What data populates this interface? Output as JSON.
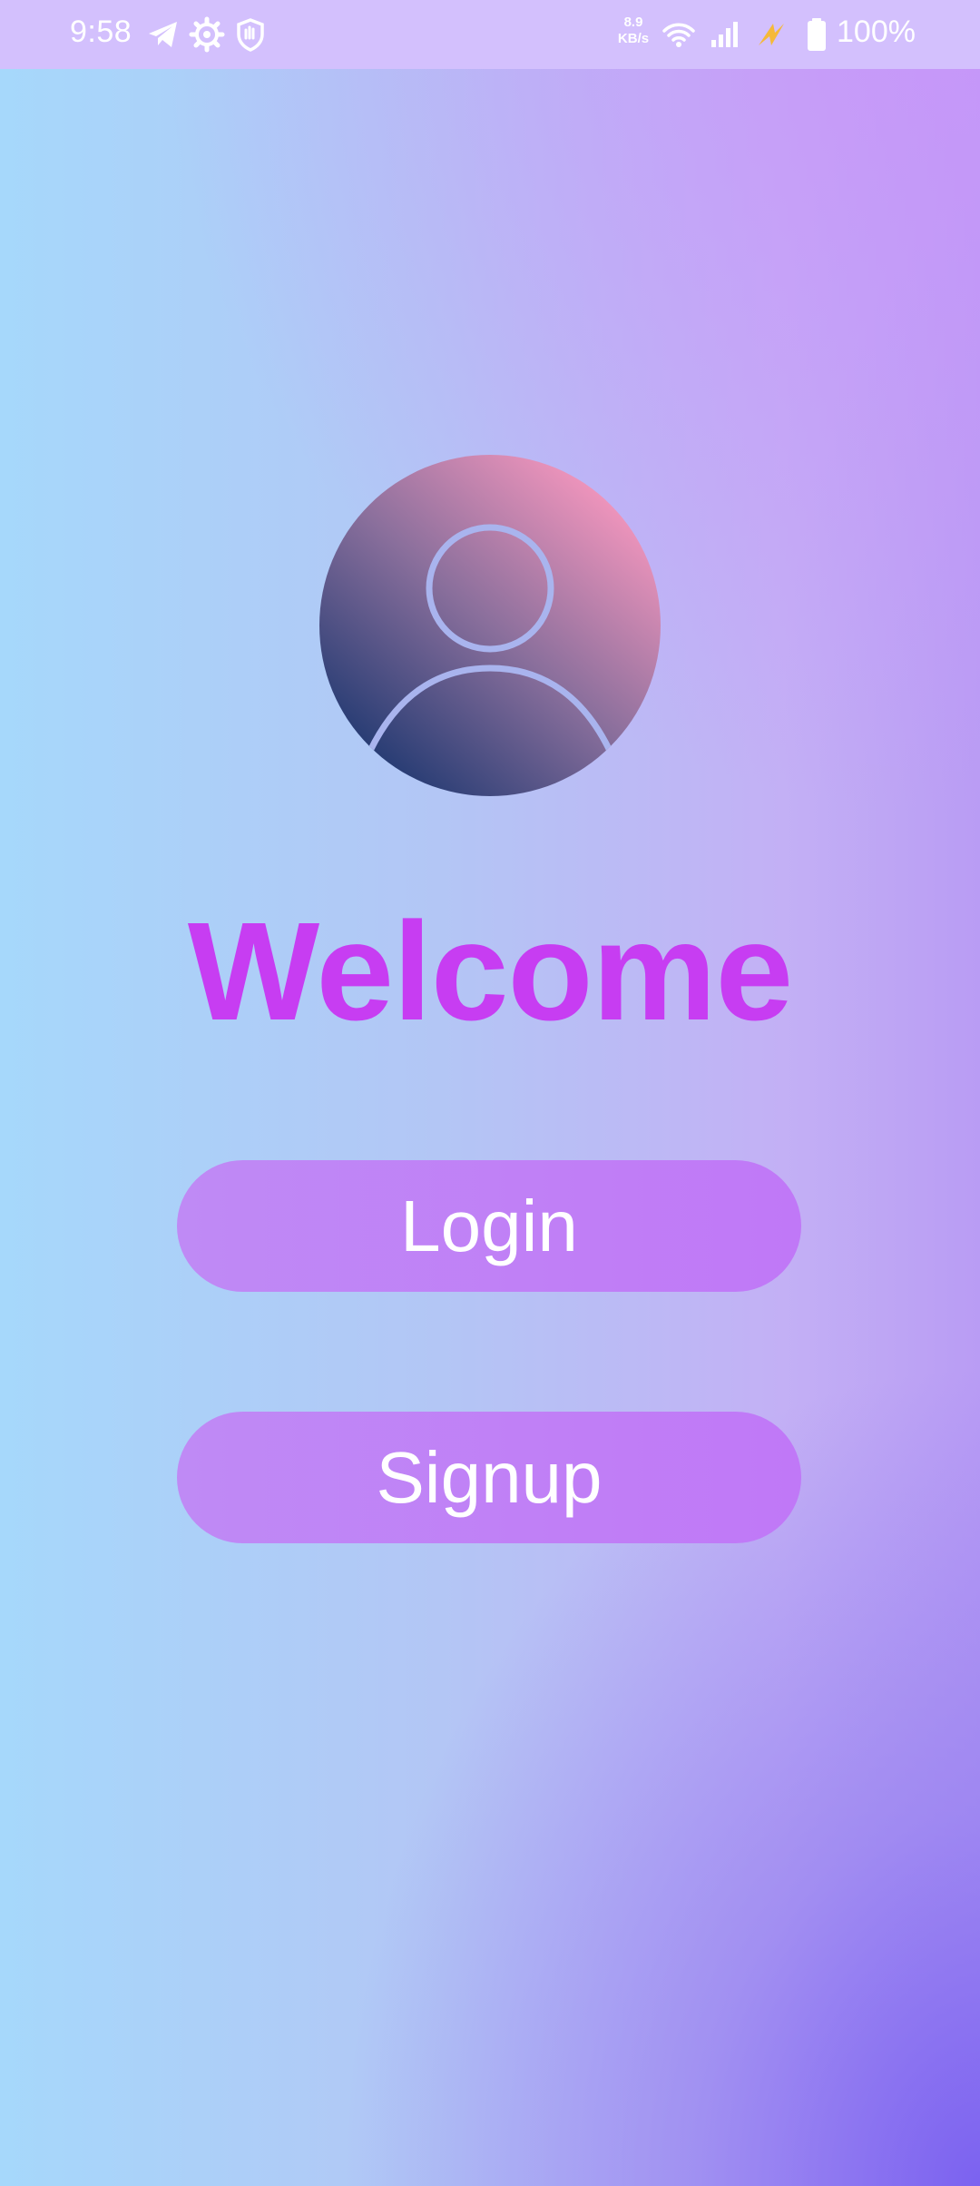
{
  "status_bar": {
    "time": "9:58",
    "icons_left": [
      "telegram-icon",
      "gear-icon",
      "shield-hand-icon"
    ],
    "net_speed_value": "8.9",
    "net_speed_unit": "KB/s",
    "icons_right": [
      "wifi-icon",
      "signal-icon",
      "charging-flash-icon",
      "battery-icon"
    ],
    "battery_percent": "100%"
  },
  "main": {
    "avatar_icon": "user-profile-icon",
    "title": "Welcome",
    "login_label": "Login",
    "signup_label": "Signup"
  },
  "colors": {
    "title": "#c73df2",
    "button": "#c080f6",
    "status_bar": "#d3c0fd"
  }
}
